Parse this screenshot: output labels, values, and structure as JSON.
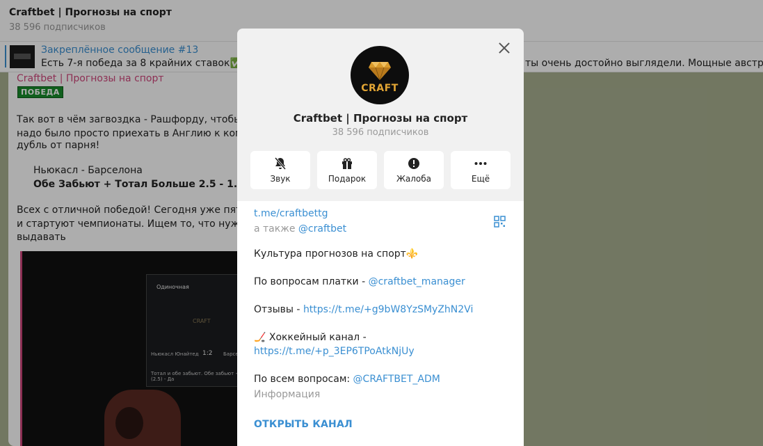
{
  "chat": {
    "title": "Craftbet | Прогнозы на спорт",
    "subscribers": "38 596 подписчиков"
  },
  "pinned": {
    "title": "Закреплённое сообщение #13",
    "text_left": "Есть 7-я победа за 8 крайних ставок✅",
    "text_right": "ты очень достойно выглядели. Мощные австрий"
  },
  "message": {
    "author": "Craftbet | Прогнозы на спорт",
    "badge": "ПОБЕДА",
    "lines": [
      "Так вот в чём загвоздка - Рашфорду, чтобы за",
      "надо было просто приехать в Англию к коман",
      "дубль от парня!",
      "Ньюкасл - Барселона",
      "Обе Забьют + Тотал Больше 2.5 - 1.67",
      "Всех с отличной победой! Сегодня уже пятни",
      "и стартуют чемпионаты. Ищем то, что нужно",
      "выдавать"
    ],
    "photo_card": {
      "bet_type": "Одиночная",
      "brand": "CRAFT",
      "match": "Ньюкасл Юнайтед",
      "score": "1:2",
      "opponent": "Барселона",
      "bet": "Тотал и обе забьют. Обе забьют + ТБ (2.5) - Да"
    }
  },
  "modal": {
    "avatar_text": "CRAFT",
    "title": "Craftbet | Прогнозы на спорт",
    "subscribers": "38 596 подписчиков",
    "actions": [
      {
        "label": "Звук",
        "icon": "bell-muted-icon"
      },
      {
        "label": "Подарок",
        "icon": "gift-icon"
      },
      {
        "label": "Жалоба",
        "icon": "report-icon"
      },
      {
        "label": "Ещё",
        "icon": "more-icon"
      }
    ],
    "link": "t.me/craftbettg",
    "also_prefix": "а также",
    "also_link": "@craftbet",
    "desc": "Культура прогнозов на спорт⚜️",
    "pay_prefix": "По вопросам платки -",
    "pay_link": "@craftbet_manager",
    "reviews_prefix": "Отзывы -",
    "reviews_link": "https://t.me/+g9bW8YzSMyZhN2Vi",
    "hockey_prefix": "🏒 Хоккейный канал -",
    "hockey_link": "https://t.me/+p_3EP6TPoAtkNjUy",
    "all_prefix": "По всем вопросам:",
    "all_link": "@CRAFTBET_ADM",
    "info_label": "Информация",
    "open_button": "ОТКРЫТЬ КАНАЛ",
    "accent_color": "#3a8fd2"
  }
}
